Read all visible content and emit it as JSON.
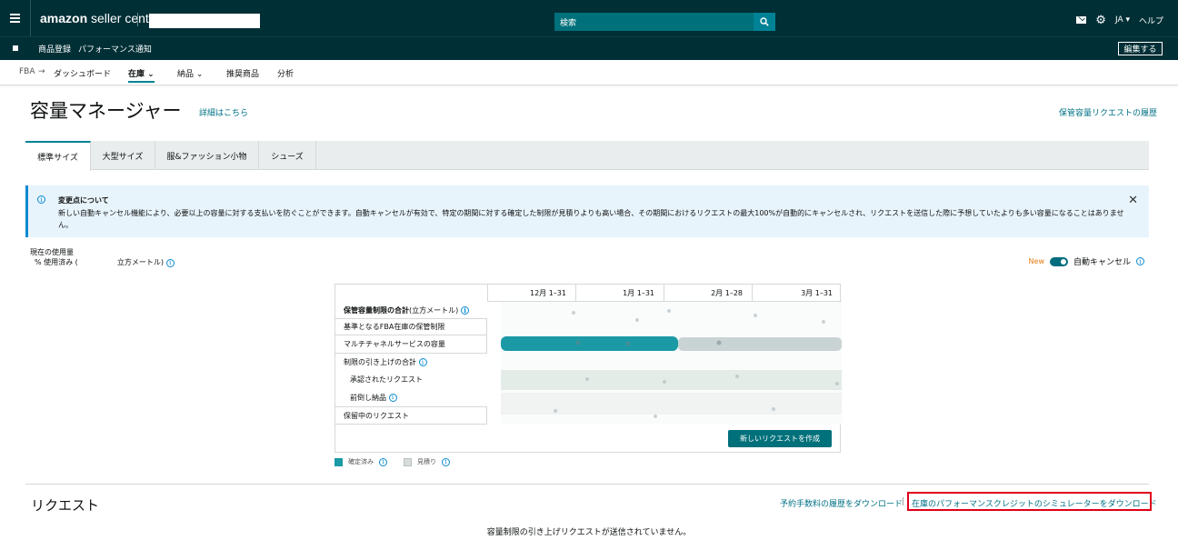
{
  "header": {
    "logo_prefix": "amazon",
    "logo_suffix": " seller central",
    "search_placeholder": "検索",
    "language": "JA ▾",
    "help": "ヘルプ",
    "bg_color": "#002f36"
  },
  "bar2": {
    "links": [
      "商品登録",
      "パフォーマンス通知"
    ],
    "edit_label": "編集する"
  },
  "subnav": {
    "fba": "FBA",
    "arrow": "→",
    "dashboard": "ダッシュボード",
    "inventory": "在庫 ⌄",
    "shipping": "納品 ⌄",
    "recommended": "推奨商品",
    "analytics": "分析"
  },
  "page": {
    "title": "容量マネージャー",
    "details_link": "詳細はこちら",
    "history_link": "保管容量リクエストの履歴"
  },
  "tabs": [
    "標準サイズ",
    "大型サイズ",
    "服&ファッション小物",
    "シューズ"
  ],
  "alert": {
    "title": "変更点について",
    "body": "新しい自動キャンセル機能により、必要以上の容量に対する支払いを防ぐことができます。自動キャンセルが有効で、特定の期間に対する確定した制限が見積りよりも高い場合、その期間におけるリクエストの最大100%が自動的にキャンセルされ、リクエストを送信した際に予想していたよりも多い容量になることはありません。"
  },
  "usage": {
    "label": "現在の使用量",
    "line": "% 使用済み (",
    "unit": "立方メートル)"
  },
  "toggle": {
    "new_badge": "New",
    "label": "自動キャンセル",
    "enabled": true
  },
  "grid": {
    "columns": [
      "12月 1–31",
      "1月 1–31",
      "2月 1–28",
      "3月 1–31"
    ],
    "rows": [
      {
        "label": "保管容量制限の合計",
        "suffix": " (立方メートル)"
      },
      {
        "label": "基準となるFBA在庫の保管制限"
      },
      {
        "label": "マルチチャネルサービスの容量"
      },
      {
        "label": "制限の引き上げの合計"
      },
      {
        "label": "承認されたリクエスト"
      },
      {
        "label": "前倒し納品"
      },
      {
        "label": "保留中のリクエスト"
      }
    ],
    "create_button": "新しいリクエストを作成",
    "legend": [
      "確定済み",
      "見積り"
    ],
    "colors": {
      "confirmed": "#1b9aa6",
      "estimate": "#c9d3d3"
    }
  },
  "requests": {
    "title": "リクエスト",
    "download_fee_history": "予約手数料の履歴をダウンロード",
    "separator": "|",
    "download_simulator": "在庫のパフォーマンスクレジットのシミュレーターをダウンロード",
    "empty": "容量制限の引き上げリクエストが送信されていません。"
  }
}
